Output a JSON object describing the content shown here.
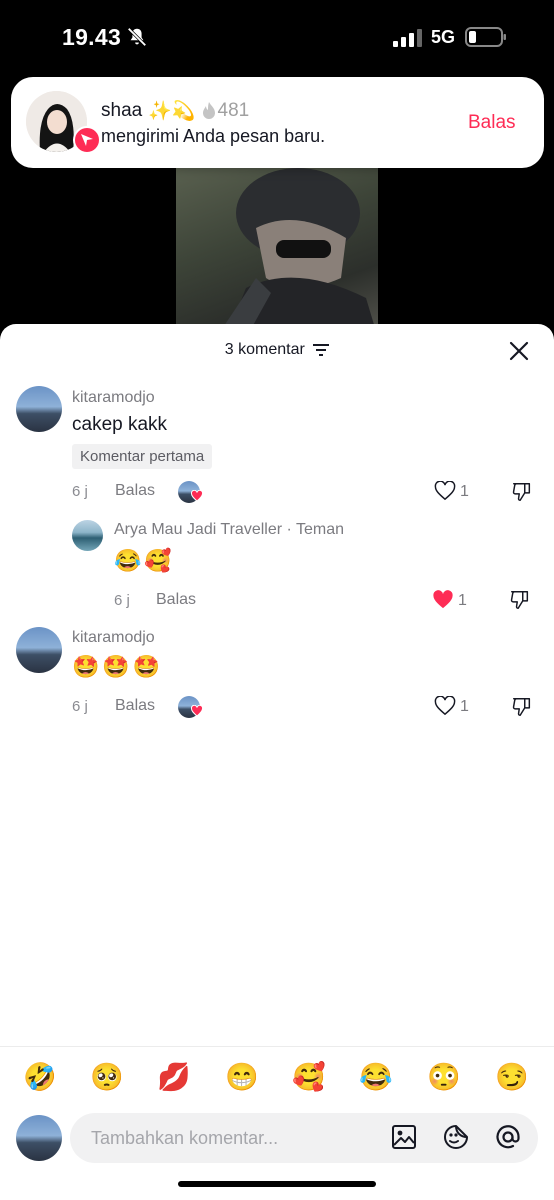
{
  "status_bar": {
    "time": "19.43",
    "network": "5G"
  },
  "notification": {
    "name": "shaa",
    "name_emojis": "✨💫",
    "stat_count": "481",
    "message": "mengirimi Anda pesan baru.",
    "reply_label": "Balas"
  },
  "sheet": {
    "title": "3 komentar"
  },
  "comments": [
    {
      "username": "kitaramodjo",
      "text": "cakep kakk",
      "chip": "Komentar pertama",
      "time": "6 j",
      "reply_label": "Balas",
      "like_count": "1",
      "liked_by_creator": true,
      "liked": false
    },
    {
      "username": "Arya Mau Jadi Traveller · Teman",
      "text": "😂🥰",
      "time": "6 j",
      "reply_label": "Balas",
      "like_count": "1",
      "liked": true
    },
    {
      "username": "kitaramodjo",
      "text": "🤩🤩🤩",
      "time": "6 j",
      "reply_label": "Balas",
      "like_count": "1",
      "liked_by_creator": true,
      "liked": false
    }
  ],
  "emoji_bar": [
    "🤣",
    "🥺",
    "💋",
    "😁",
    "🥰",
    "😂",
    "😳",
    "😏"
  ],
  "input": {
    "placeholder": "Tambahkan komentar..."
  },
  "colors": {
    "accent": "#fe2c55",
    "text": "#161823",
    "muted": "#7b7b80"
  }
}
